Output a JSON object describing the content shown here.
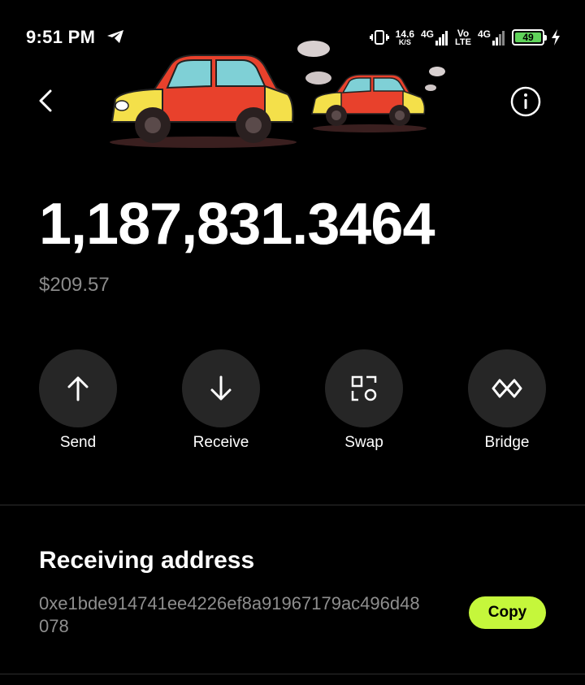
{
  "status_bar": {
    "time": "9:51 PM",
    "net_speed_value": "14.6",
    "net_speed_unit": "K/S",
    "sim1_label": "4G",
    "volte_top": "Vo",
    "volte_bottom": "LTE",
    "sim2_label": "4G",
    "battery_level": "49",
    "icons": [
      "telegram-icon",
      "vibrate-icon",
      "signal-icon",
      "charging-icon"
    ]
  },
  "token": {
    "balance": "1,187,831.3464",
    "fiat_value": "$209.57"
  },
  "actions": [
    {
      "label": "Send",
      "icon": "arrow-up-icon"
    },
    {
      "label": "Receive",
      "icon": "arrow-down-icon"
    },
    {
      "label": "Swap",
      "icon": "swap-icon"
    },
    {
      "label": "Bridge",
      "icon": "bridge-icon"
    }
  ],
  "receiving": {
    "title": "Receiving address",
    "address": "0xe1bde914741ee4226ef8a91967179ac496d48078",
    "copy_label": "Copy"
  },
  "colors": {
    "background": "#000000",
    "button_circle": "#262626",
    "accent": "#c5f73b",
    "muted_text": "#8a8a8a"
  }
}
